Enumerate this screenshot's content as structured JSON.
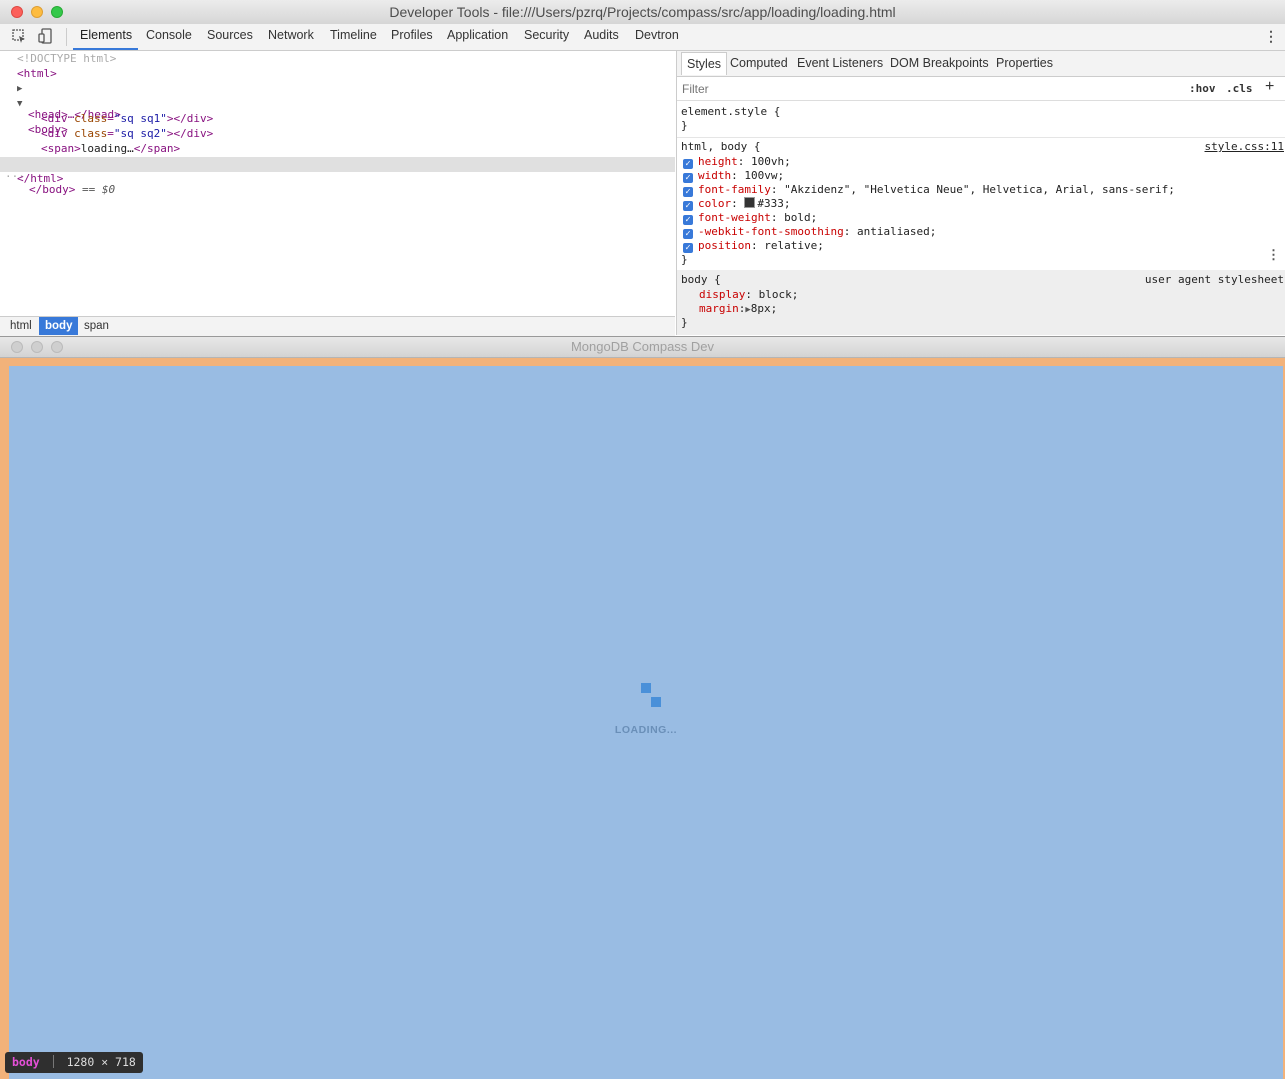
{
  "devtools": {
    "window_title": "Developer Tools - file:///Users/pzrq/Projects/compass/src/app/loading/loading.html",
    "tabs": [
      "Elements",
      "Console",
      "Sources",
      "Network",
      "Timeline",
      "Profiles",
      "Application",
      "Security",
      "Audits",
      "Devtron"
    ],
    "active_tab": "Elements",
    "dom": {
      "doctype": "<!DOCTYPE html>",
      "html_open": "<html>",
      "head_collapsed": "<head>…</head>",
      "body_open": "<body>",
      "div1_open": "<div",
      "div1_attr": "class",
      "div1_val": "\"sq sq1\"",
      "div1_close": "></div>",
      "div2_open": "<div",
      "div2_attr": "class",
      "div2_val": "\"sq sq2\"",
      "div2_close": "></div>",
      "span_open": "<span>",
      "span_text": "loading…",
      "span_close": "</span>",
      "body_close": "</body>",
      "selected_marker": "== $0",
      "html_close": "</html>"
    },
    "breadcrumbs": [
      "html",
      "body",
      "span"
    ],
    "selected_crumb": "body",
    "styles_tabs": [
      "Styles",
      "Computed",
      "Event Listeners",
      "DOM Breakpoints",
      "Properties"
    ],
    "filter_placeholder": "Filter",
    "hov": ":hov",
    "cls": ".cls",
    "add": "+",
    "element_style": "element.style {",
    "close_brace": "}",
    "rule1_selector": "html, body {",
    "rule1_source": "style.css:11",
    "rule1_props": [
      {
        "name": "height",
        "value": "100vh;"
      },
      {
        "name": "width",
        "value": "100vw;"
      },
      {
        "name": "font-family",
        "value": "\"Akzidenz\", \"Helvetica Neue\", Helvetica, Arial, sans-serif;"
      },
      {
        "name": "color",
        "value": "#333;"
      },
      {
        "name": "font-weight",
        "value": "bold;"
      },
      {
        "name": "-webkit-font-smoothing",
        "value": "antialiased;"
      },
      {
        "name": "position",
        "value": "relative;"
      }
    ],
    "rule2_selector": "body {",
    "rule2_source": "user agent stylesheet",
    "rule2_props": [
      {
        "name": "display",
        "value": "block;"
      },
      {
        "name": "margin",
        "value": "8px;"
      }
    ]
  },
  "app": {
    "window_title": "MongoDB Compass Dev",
    "loading_text": "LOADING..."
  },
  "badge": {
    "element": "body",
    "size": "1280 × 718"
  },
  "colors": {
    "app_background": "#99bce3",
    "app_frame": "#f2b27a",
    "accent": "#3879d9",
    "spinner": "#4a90d9"
  }
}
